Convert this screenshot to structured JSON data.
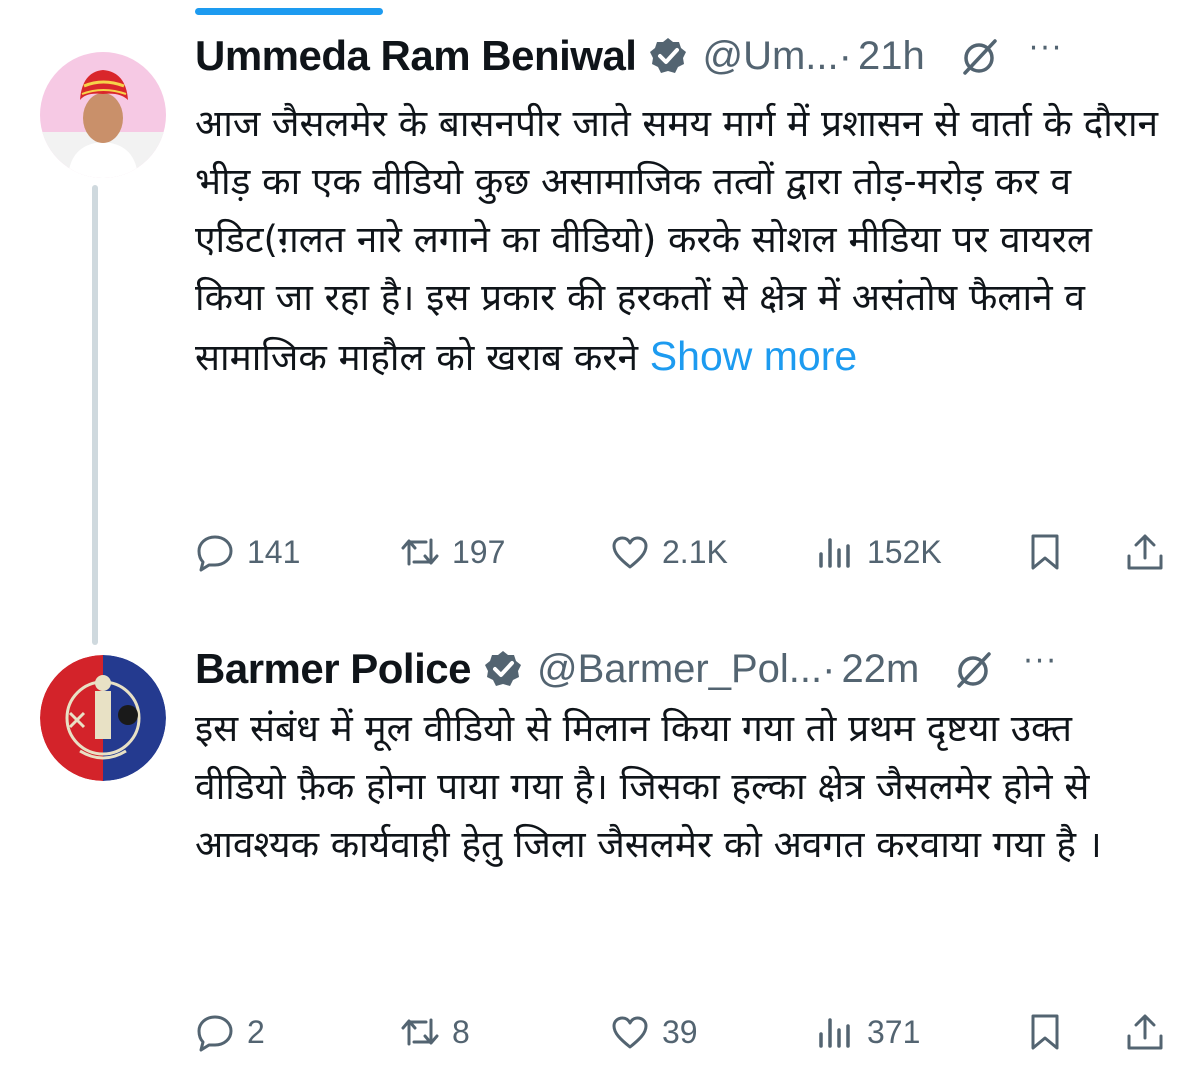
{
  "tweets": [
    {
      "name": "Ummeda Ram Beniwal",
      "handle": "@Um...",
      "time": "21h",
      "text": "आज जैसलमेर के बासनपीर जाते समय मार्ग में प्रशासन से वार्ता के दौरान भीड़ का एक वीडियो कुछ असामाजिक तत्वों द्वारा तोड़-मरोड़ कर व एडिट(ग़लत नारे लगाने का वीडियो) करके सोशल मीडिया पर वायरल किया जा रहा है। इस प्रकार की हरकतों से क्षेत्र में असंतोष फैलाने व सामाजिक माहौल को खराब करने",
      "show_more": "Show more",
      "replies": "141",
      "retweets": "197",
      "likes": "2.1K",
      "views": "152K"
    },
    {
      "name": "Barmer Police",
      "handle": "@Barmer_Pol...",
      "time": "22m",
      "text": "इस संबंध में मूल वीडियो से मिलान किया गया तो प्रथम दृष्टया उक्त वीडियो फ़ैक होना पाया गया है। जिसका हल्का क्षेत्र जैसलमेर होने से आवश्यक कार्यवाही हेतु जिला जैसलमेर को अवगत करवाया गया है ।",
      "replies": "2",
      "retweets": "8",
      "likes": "39",
      "views": "371"
    }
  ],
  "separator": "·",
  "more_menu": "···",
  "colors": {
    "accent": "#1d9bf0",
    "muted": "#536471",
    "text": "#0f1419",
    "thread_line": "#cfd9de"
  },
  "icons": [
    "verified-badge-icon",
    "grok-icon",
    "more-icon",
    "reply-icon",
    "retweet-icon",
    "like-icon",
    "views-icon",
    "bookmark-icon",
    "share-icon"
  ]
}
